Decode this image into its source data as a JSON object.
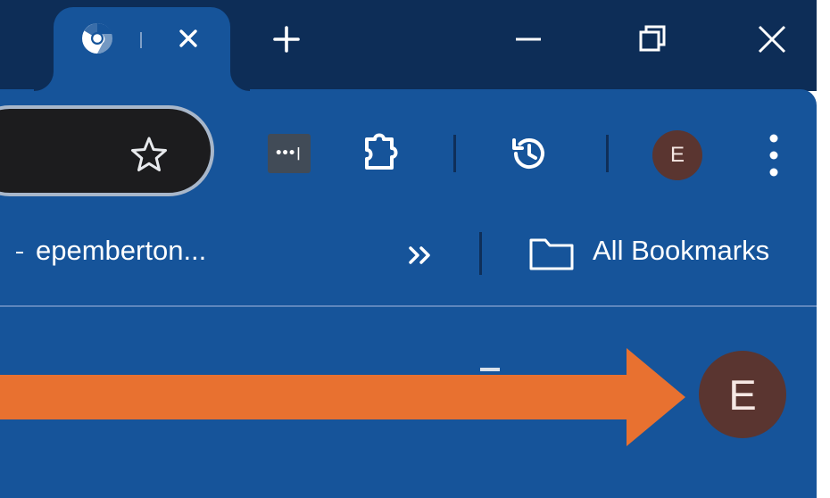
{
  "browser": {
    "tab": {
      "close_symbol": "×",
      "favicon": "chrome-icon"
    },
    "new_tab_symbol": "+",
    "window_controls": {
      "minimize": "minimize-icon",
      "restore": "restore-icon",
      "close": "close-icon"
    }
  },
  "toolbar": {
    "bookmark_star": "star-icon",
    "password_extension_dots": "•••|",
    "extensions": "puzzle-icon",
    "history": "history-icon",
    "profile_initial": "E",
    "menu": "more-vert-icon"
  },
  "bookmarks_bar": {
    "truncated_item": "epemberton...",
    "overflow_chevron": "»",
    "all_bookmarks_label": "All Bookmarks"
  },
  "content": {
    "profile_initial_large": "E",
    "arrow_color": "#e87130"
  },
  "colors": {
    "frame": "#16549a",
    "titlebar": "#0d2d57",
    "avatar": "#5a3530",
    "omnibox": "#1c1c1e"
  }
}
